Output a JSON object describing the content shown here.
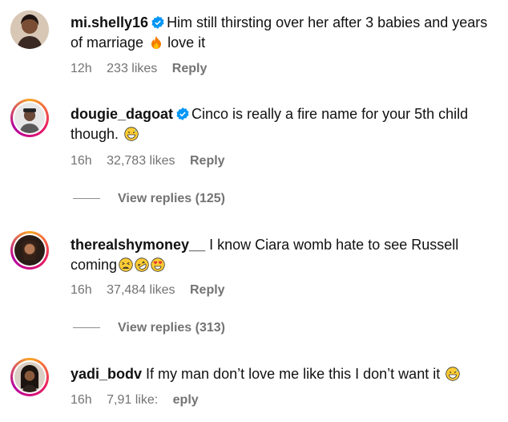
{
  "comments": [
    {
      "username": "mi.shelly16",
      "verified": true,
      "text": "Him still thirsting over her after 3 babies and years of marriage",
      "text_after_emoji": "love it",
      "emoji": "fire",
      "time": "12h",
      "likes": "233 likes",
      "reply": "Reply"
    },
    {
      "username": "dougie_dagoat",
      "verified": true,
      "text": "Cinco is really a fire name for your 5th child though.",
      "emoji": "grinning-sweat",
      "time": "16h",
      "likes": "32,783 likes",
      "reply": "Reply",
      "view_replies": "View replies (125)"
    },
    {
      "username": "therealshymoney__",
      "verified": false,
      "text": "I know Ciara womb hate to see Russell coming",
      "emoji": "tired-face rofl heart-eyes",
      "time": "16h",
      "likes": "37,484 likes",
      "reply": "Reply",
      "view_replies": "View replies (313)"
    },
    {
      "username": "yadi_bodv",
      "verified": false,
      "text": "If my man don’t love me like this I don’t want it",
      "emoji": "grinning-sweat",
      "time": "16h",
      "likes": "7,91  like:",
      "reply": "eply"
    }
  ],
  "colors": {
    "meta": "#737373",
    "verified": "#0095f6",
    "ring": "#e91e63"
  }
}
